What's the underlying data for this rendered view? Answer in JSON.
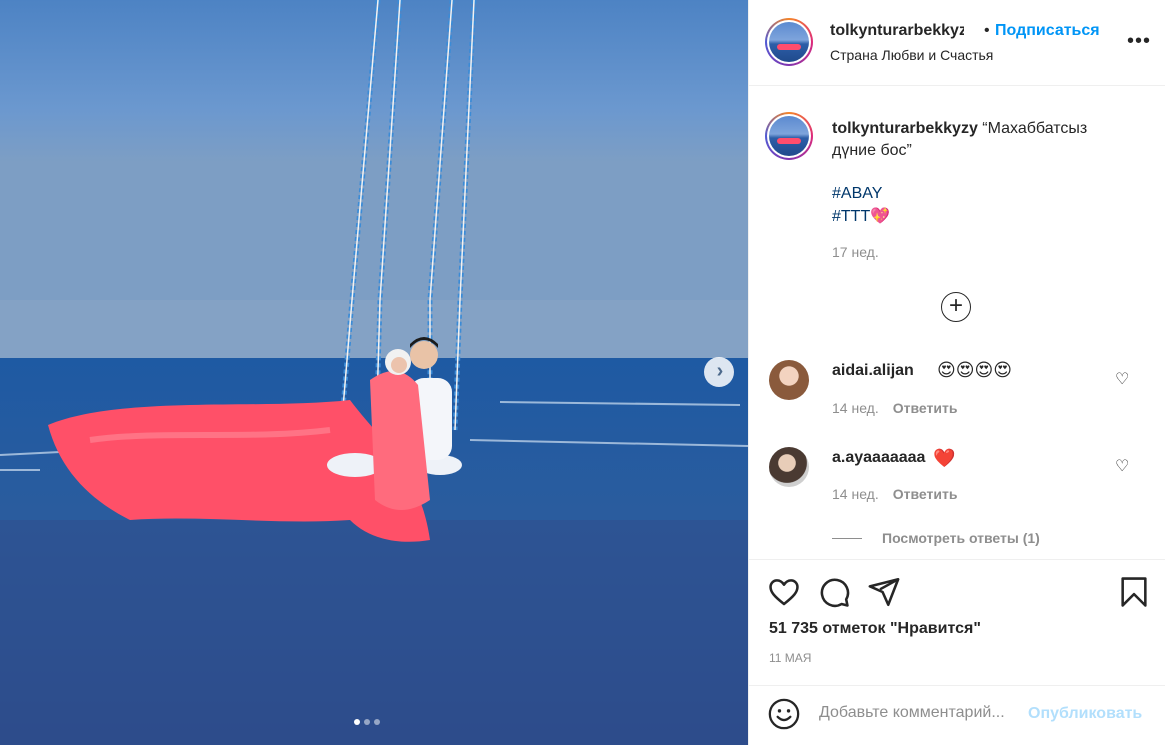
{
  "header": {
    "username": "tolkynturarbekkyzy",
    "bullet": "•",
    "follow_label": "Подписаться",
    "location": "Страна Любви и Счастья",
    "more_icon": "more-horizontal-icon",
    "more_glyph": "•••"
  },
  "caption": {
    "username": "tolkynturarbekkyzy",
    "text": "“Махаббатсыз дүние бос”",
    "hashtags": [
      "#ABAY",
      "#TTT"
    ],
    "heart": "💖",
    "age": "17 нед."
  },
  "load_more": {
    "icon": "plus-circle-icon",
    "glyph": "+"
  },
  "comments": [
    {
      "username": "aidai.alijan",
      "emojis": "😍😍😍😍",
      "age": "14 нед.",
      "reply_label": "Ответить",
      "like_glyph": "♡"
    },
    {
      "username": "a.ayaaaaaaa",
      "emojis": "❤️",
      "age": "14 нед.",
      "reply_label": "Ответить",
      "like_glyph": "♡"
    }
  ],
  "view_replies": "Посмотреть ответы (1)",
  "actions": {
    "icons": [
      "heart-icon",
      "comment-icon",
      "share-icon",
      "bookmark-icon"
    ],
    "likes": "51 735 отметок \"Нравится\"",
    "date": "11 МАЯ"
  },
  "add_comment": {
    "placeholder": "Добавьте комментарий...",
    "publish_label": "Опубликовать"
  },
  "media": {
    "next_glyph": "›",
    "carousel_index": 1,
    "carousel_count": 3
  },
  "colors": {
    "accent_blue": "#0095f6",
    "hashtag": "#00376b",
    "muted": "#8e8e8e",
    "publish_disabled": "#b2dffc",
    "dress": "#ff4f66"
  }
}
